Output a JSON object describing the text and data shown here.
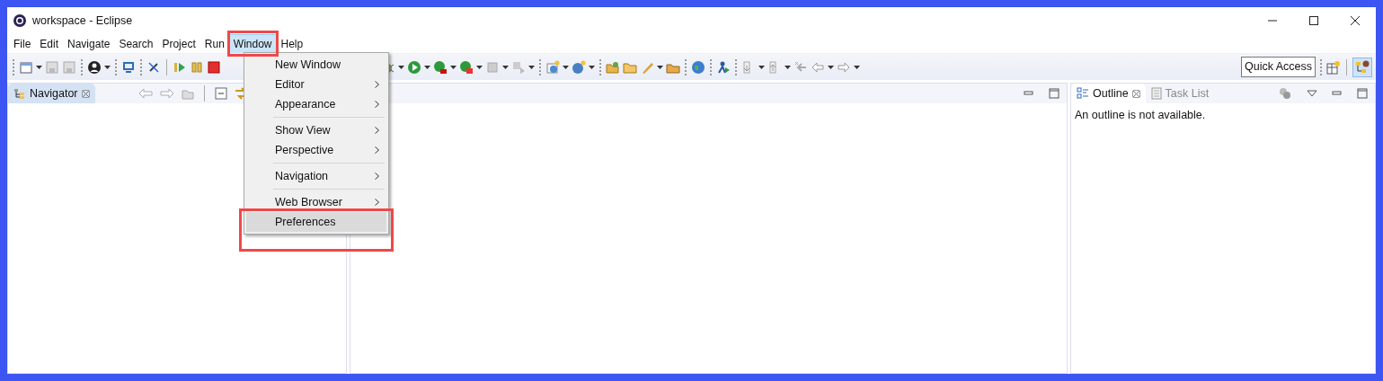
{
  "window": {
    "title": "workspace - Eclipse"
  },
  "menu_bar": [
    {
      "label": "File",
      "selected": false
    },
    {
      "label": "Edit",
      "selected": false
    },
    {
      "label": "Navigate",
      "selected": false
    },
    {
      "label": "Search",
      "selected": false
    },
    {
      "label": "Project",
      "selected": false
    },
    {
      "label": "Run",
      "selected": false
    },
    {
      "label": "Window",
      "selected": true
    },
    {
      "label": "Help",
      "selected": false
    }
  ],
  "window_menu": {
    "groups": [
      [
        {
          "label": "New Window",
          "submenu": false,
          "highlighted": false
        },
        {
          "label": "Editor",
          "submenu": true,
          "highlighted": false
        },
        {
          "label": "Appearance",
          "submenu": true,
          "highlighted": false
        }
      ],
      [
        {
          "label": "Show View",
          "submenu": true,
          "highlighted": false
        },
        {
          "label": "Perspective",
          "submenu": true,
          "highlighted": false
        }
      ],
      [
        {
          "label": "Navigation",
          "submenu": true,
          "highlighted": false
        }
      ],
      [
        {
          "label": "Web Browser",
          "submenu": true,
          "highlighted": false
        },
        {
          "label": "Preferences",
          "submenu": false,
          "highlighted": true
        }
      ]
    ]
  },
  "toolbar": {
    "quick_access": "Quick Access"
  },
  "navigator": {
    "tabs": [
      {
        "label": "Navigator",
        "selected": true
      }
    ]
  },
  "outline": {
    "tabs": [
      {
        "label": "Outline",
        "selected": true
      },
      {
        "label": "Task List",
        "selected": false
      }
    ],
    "message": "An outline is not available."
  }
}
